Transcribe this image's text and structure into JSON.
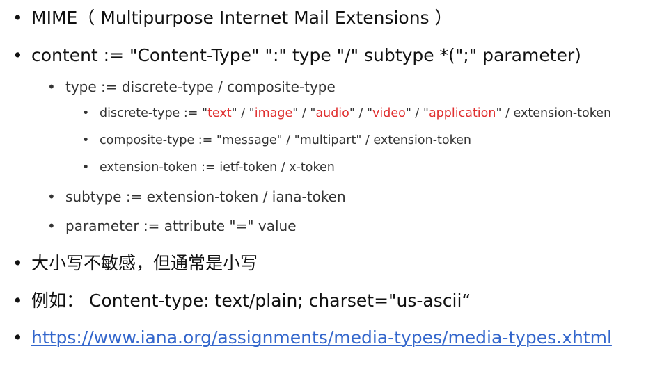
{
  "bullet_char": "•",
  "items": {
    "mime": {
      "text": "MIME（ Multipurpose Internet Mail Extensions ）"
    },
    "content": {
      "text": "content := \"Content-Type\" \":\" type \"/\" subtype *(\";\" parameter)"
    },
    "type_rule": {
      "text": "type := discrete-type / composite-type"
    },
    "discrete": {
      "prefix": "discrete-type := \"",
      "text_value": "text",
      "sep1": "\" / \"",
      "image_value": "image",
      "sep2": "\" / \"",
      "audio_value": "audio",
      "sep3": "\" / \"",
      "video_value": "video",
      "sep4": "\" / \"",
      "application_value": "application",
      "suffix": "\" / extension-token",
      "highlight_color": "#e03030"
    },
    "composite": {
      "text": "composite-type := \"message\" / \"multipart\" / extension-token"
    },
    "extension": {
      "text": "extension-token := ietf-token / x-token"
    },
    "subtype": {
      "text": "subtype := extension-token / iana-token"
    },
    "parameter": {
      "text": "parameter := attribute \"=\" value"
    },
    "case_note": {
      "text": "大小写不敏感，但通常是小写"
    },
    "example": {
      "text": "例如： Content-type: text/plain; charset=\"us-ascii“"
    },
    "link": {
      "text": "https://www.iana.org/assignments/media-types/media-types.xhtml",
      "color": "#3366cc"
    }
  }
}
